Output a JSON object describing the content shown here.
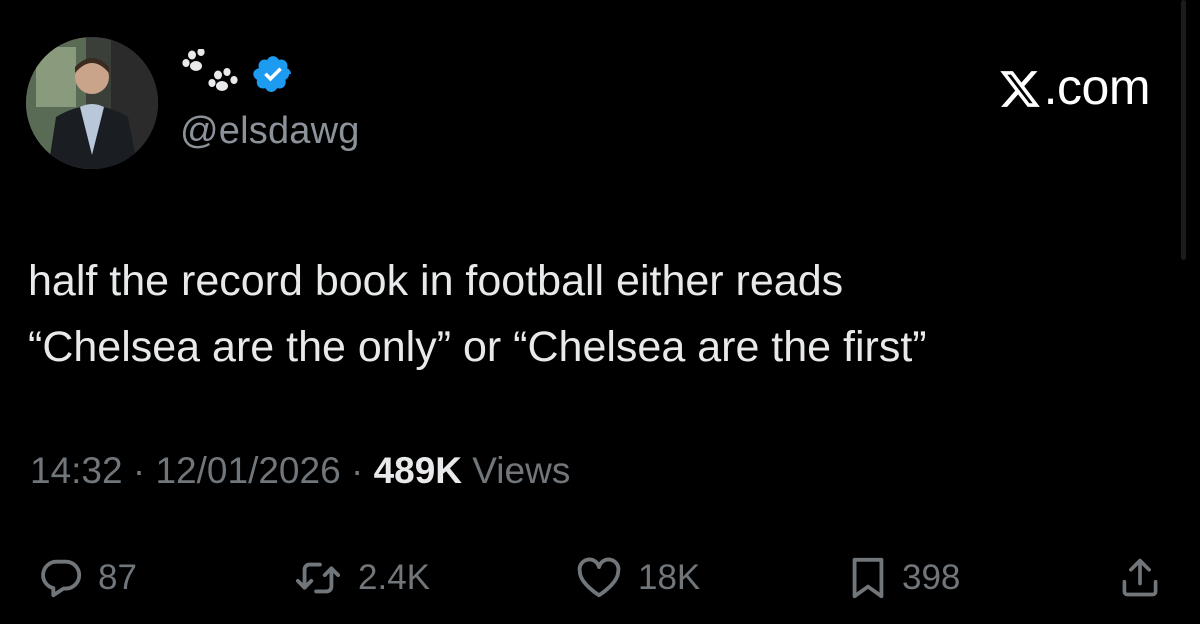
{
  "profile": {
    "avatar_icon": "avatar-photo",
    "display_name_icons": [
      "paw-print-icon",
      "verified-badge-icon"
    ],
    "handle": "@elsdawg"
  },
  "brand": {
    "label": ".com",
    "logo_icon": "x-logo-icon"
  },
  "tweet": {
    "lines": [
      "half the record book in football either reads",
      "“Chelsea are the only” or “Chelsea are the first”"
    ],
    "time": "14:32",
    "separator": "·",
    "date": "12/01/2026",
    "views_count": "489K",
    "views_label": "Views"
  },
  "actions": {
    "replies": "87",
    "reposts": "2.4K",
    "likes": "18K",
    "bookmarks": "398"
  },
  "colors": {
    "background": "#000000",
    "text": "#e7e9ea",
    "muted": "#71767b",
    "verified": "#1d9bf0"
  }
}
